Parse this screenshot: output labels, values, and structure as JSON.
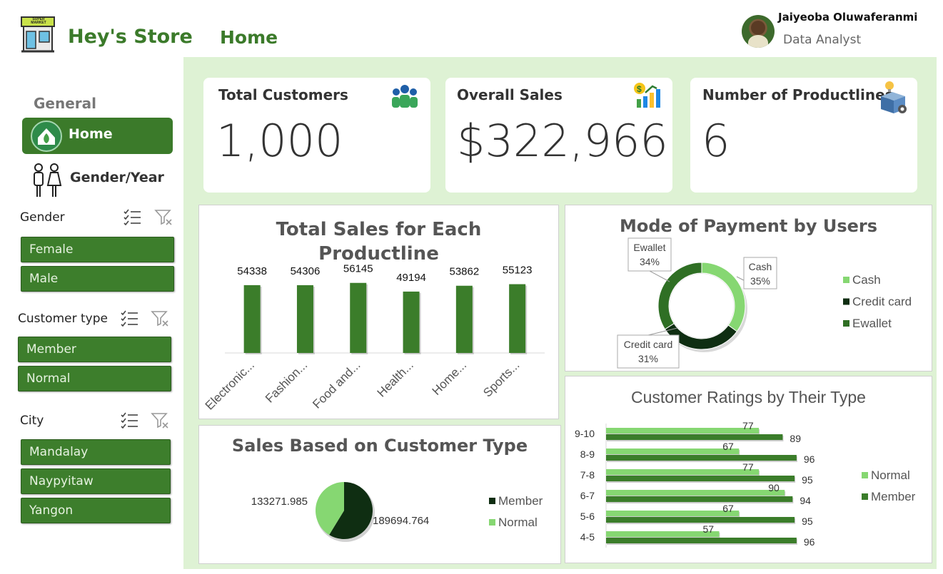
{
  "header": {
    "store_name": "Hey's Store",
    "page": "Home",
    "user_name": "Jaiyeoba Oluwaferanmi",
    "user_role": "Data Analyst",
    "logo_text": "SUPER MARKET"
  },
  "sidebar": {
    "section": "General",
    "nav": [
      {
        "label": "Home",
        "icon": "home-icon",
        "active": true
      },
      {
        "label": "Gender/Year",
        "icon": "people-icon",
        "active": false
      }
    ],
    "slicers": [
      {
        "title": "Gender",
        "items": [
          "Female",
          "Male"
        ]
      },
      {
        "title": "Customer type",
        "items": [
          "Member",
          "Normal"
        ]
      },
      {
        "title": "City",
        "items": [
          "Mandalay",
          "Naypyitaw",
          "Yangon"
        ]
      }
    ]
  },
  "kpis": [
    {
      "title": "Total Customers",
      "value": "1,000",
      "icon": "customers-icon"
    },
    {
      "title": "Overall Sales",
      "value": "$322,966",
      "icon": "sales-growth-icon"
    },
    {
      "title": "Number of Productlines",
      "value": "6",
      "icon": "product-box-icon"
    }
  ],
  "colors": {
    "dark_green": "#0f2e12",
    "mid_green": "#3b7d2a",
    "light_green": "#86d772",
    "panel_bg": "#def2d4"
  },
  "chart_data": [
    {
      "type": "bar",
      "title": "Total Sales for Each Productline",
      "categories": [
        "Electronic...",
        "Fashion...",
        "Food and...",
        "Health...",
        "Home...",
        "Sports..."
      ],
      "values": [
        54338,
        54306,
        56145,
        49194,
        53862,
        55123
      ],
      "ylim": [
        0,
        60000
      ]
    },
    {
      "type": "pie",
      "subtype": "doughnut",
      "title": "Mode of Payment by Users",
      "labels": [
        "Cash",
        "Credit card",
        "Ewallet"
      ],
      "values": [
        35,
        31,
        34
      ],
      "value_labels": [
        "35%",
        "31%",
        "34%"
      ],
      "colors": [
        "#86d772",
        "#0f2e12",
        "#2f6f24"
      ],
      "legend": "right"
    },
    {
      "type": "pie",
      "title": "Sales Based on Customer Type",
      "labels": [
        "Member",
        "Normal"
      ],
      "values": [
        189694.764,
        133271.985
      ],
      "value_labels": [
        "189694.764",
        "133271.985"
      ],
      "colors": [
        "#0f2e12",
        "#86d772"
      ],
      "legend": "right"
    },
    {
      "type": "bar",
      "orientation": "horizontal",
      "title": "Customer Ratings by Their Type",
      "categories": [
        "9-10",
        "8-9",
        "7-8",
        "6-7",
        "5-6",
        "4-5"
      ],
      "series": [
        {
          "name": "Normal",
          "values": [
            77,
            67,
            77,
            90,
            67,
            57
          ],
          "color": "#86d772"
        },
        {
          "name": "Member",
          "values": [
            89,
            96,
            95,
            94,
            95,
            96
          ],
          "color": "#3b7d2a"
        }
      ],
      "xlim": [
        0,
        100
      ],
      "legend": "right"
    }
  ]
}
